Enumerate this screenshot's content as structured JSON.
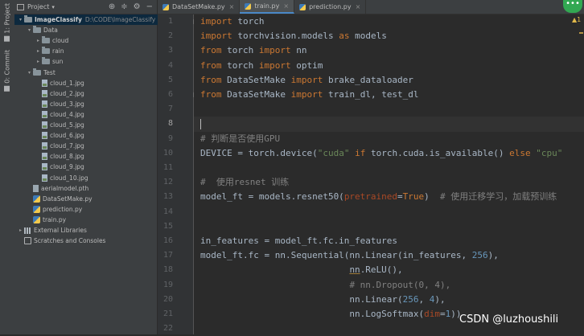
{
  "sidebar_strip": {
    "project_tab": "1: Project",
    "commit_tab": "0: Commit"
  },
  "project_panel": {
    "header_label": "Project",
    "tree": [
      {
        "label": "ImageClassify",
        "note": "D:\\CODE\\ImageClassify",
        "kind": "root",
        "expanded": true
      },
      {
        "label": "Data",
        "kind": "folder",
        "expanded": true
      },
      {
        "label": "cloud",
        "kind": "folder",
        "expanded": false
      },
      {
        "label": "rain",
        "kind": "folder",
        "expanded": false
      },
      {
        "label": "sun",
        "kind": "folder",
        "expanded": false
      },
      {
        "label": "Test",
        "kind": "folder",
        "expanded": true
      },
      {
        "label": "cloud_1.jpg",
        "kind": "image"
      },
      {
        "label": "cloud_2.jpg",
        "kind": "image"
      },
      {
        "label": "cloud_3.jpg",
        "kind": "image"
      },
      {
        "label": "cloud_4.jpg",
        "kind": "image"
      },
      {
        "label": "cloud_5.jpg",
        "kind": "image"
      },
      {
        "label": "cloud_6.jpg",
        "kind": "image"
      },
      {
        "label": "cloud_7.jpg",
        "kind": "image"
      },
      {
        "label": "cloud_8.jpg",
        "kind": "image"
      },
      {
        "label": "cloud_9.jpg",
        "kind": "image"
      },
      {
        "label": "cloud_10.jpg",
        "kind": "image"
      },
      {
        "label": "aerialmodel.pth",
        "kind": "pth"
      },
      {
        "label": "DataSetMake.py",
        "kind": "py"
      },
      {
        "label": "prediction.py",
        "kind": "py"
      },
      {
        "label": "train.py",
        "kind": "py"
      },
      {
        "label": "External Libraries",
        "kind": "lib",
        "expanded": false
      },
      {
        "label": "Scratches and Consoles",
        "kind": "scratch"
      }
    ]
  },
  "tabs": [
    {
      "label": "DataSetMake.py",
      "active": false
    },
    {
      "label": "train.py",
      "active": true
    },
    {
      "label": "prediction.py",
      "active": false
    }
  ],
  "editor": {
    "line_numbers": [
      "1",
      "2",
      "3",
      "4",
      "5",
      "6",
      "7",
      "8",
      "9",
      "10",
      "11",
      "12",
      "13",
      "14",
      "15",
      "16",
      "17",
      "18",
      "19",
      "20",
      "21",
      "22"
    ],
    "current_line": 8,
    "warning_badge": "▲1",
    "more_button": "•••"
  },
  "watermark": "CSDN @luzhoushili",
  "colors": {
    "keyword": "#cc7832",
    "comment": "#808080",
    "string": "#6a8759",
    "number": "#6897bb",
    "param": "#aa4926",
    "text": "#a9b7c6",
    "background": "#2b2b2b"
  }
}
